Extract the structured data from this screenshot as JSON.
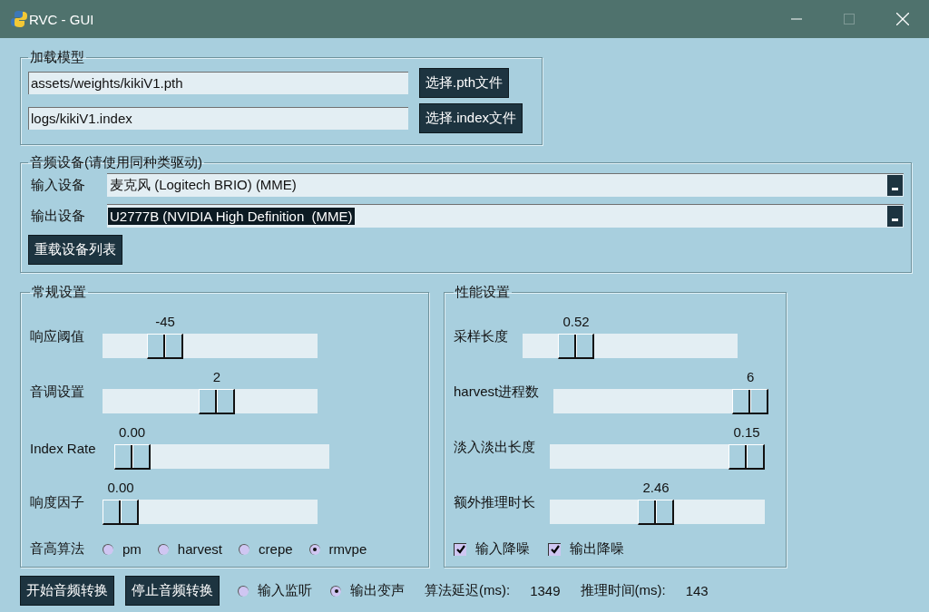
{
  "window": {
    "title": "RVC - GUI"
  },
  "load_model": {
    "title": "加载模型",
    "rows": [
      {
        "path": "assets/weights/kikiV1.pth",
        "button": "选择.pth文件"
      },
      {
        "path": "logs/kikiV1.index",
        "button": "选择.index文件"
      }
    ]
  },
  "audio_devices": {
    "title": "音频设备(请使用同种类驱动)",
    "devices": [
      {
        "label": "输入设备",
        "value": "麦克风 (Logitech BRIO) (MME)",
        "highlighted": false
      },
      {
        "label": "输出设备",
        "value": "U2777B (NVIDIA High Definition  (MME)",
        "highlighted": true
      }
    ],
    "reload_button": "重载设备列表"
  },
  "general": {
    "title": "常规设置",
    "sliders": [
      {
        "label": "响应阈值",
        "reading": "-45",
        "level": 0.25
      },
      {
        "label": "音调设置",
        "reading": "2",
        "level": 0.54
      },
      {
        "label": "Index Rate",
        "reading": "0.00",
        "level": 0
      },
      {
        "label": "响度因子",
        "reading": "0.00",
        "level": 0
      }
    ],
    "pitch_algorithm": {
      "label": "音高算法",
      "options": [
        {
          "label": "pm",
          "selected": false
        },
        {
          "label": "harvest",
          "selected": false
        },
        {
          "label": "crepe",
          "selected": false
        },
        {
          "label": "rmvpe",
          "selected": true
        }
      ]
    }
  },
  "performance": {
    "title": "性能设置",
    "sliders": [
      {
        "label": "采样长度",
        "reading": "0.52",
        "level": 0.2
      },
      {
        "label": "harvest进程数",
        "reading": "6",
        "level": 1
      },
      {
        "label": "淡入淡出长度",
        "reading": "0.15",
        "level": 1
      },
      {
        "label": "额外推理时长",
        "reading": "2.46",
        "level": 0.49
      }
    ],
    "checkboxes": [
      {
        "label": "输入降噪",
        "checked": true
      },
      {
        "label": "输出降噪",
        "checked": true
      }
    ]
  },
  "bottom_bar": {
    "buttons": [
      "开始音频转换",
      "停止音频转换"
    ],
    "modes": [
      {
        "label": "输入监听",
        "selected": false
      },
      {
        "label": "输出变声",
        "selected": true
      }
    ],
    "stats": [
      {
        "label": "算法延迟(ms):",
        "value": "1349"
      },
      {
        "label": "推理时间(ms):",
        "value": "143"
      }
    ]
  }
}
